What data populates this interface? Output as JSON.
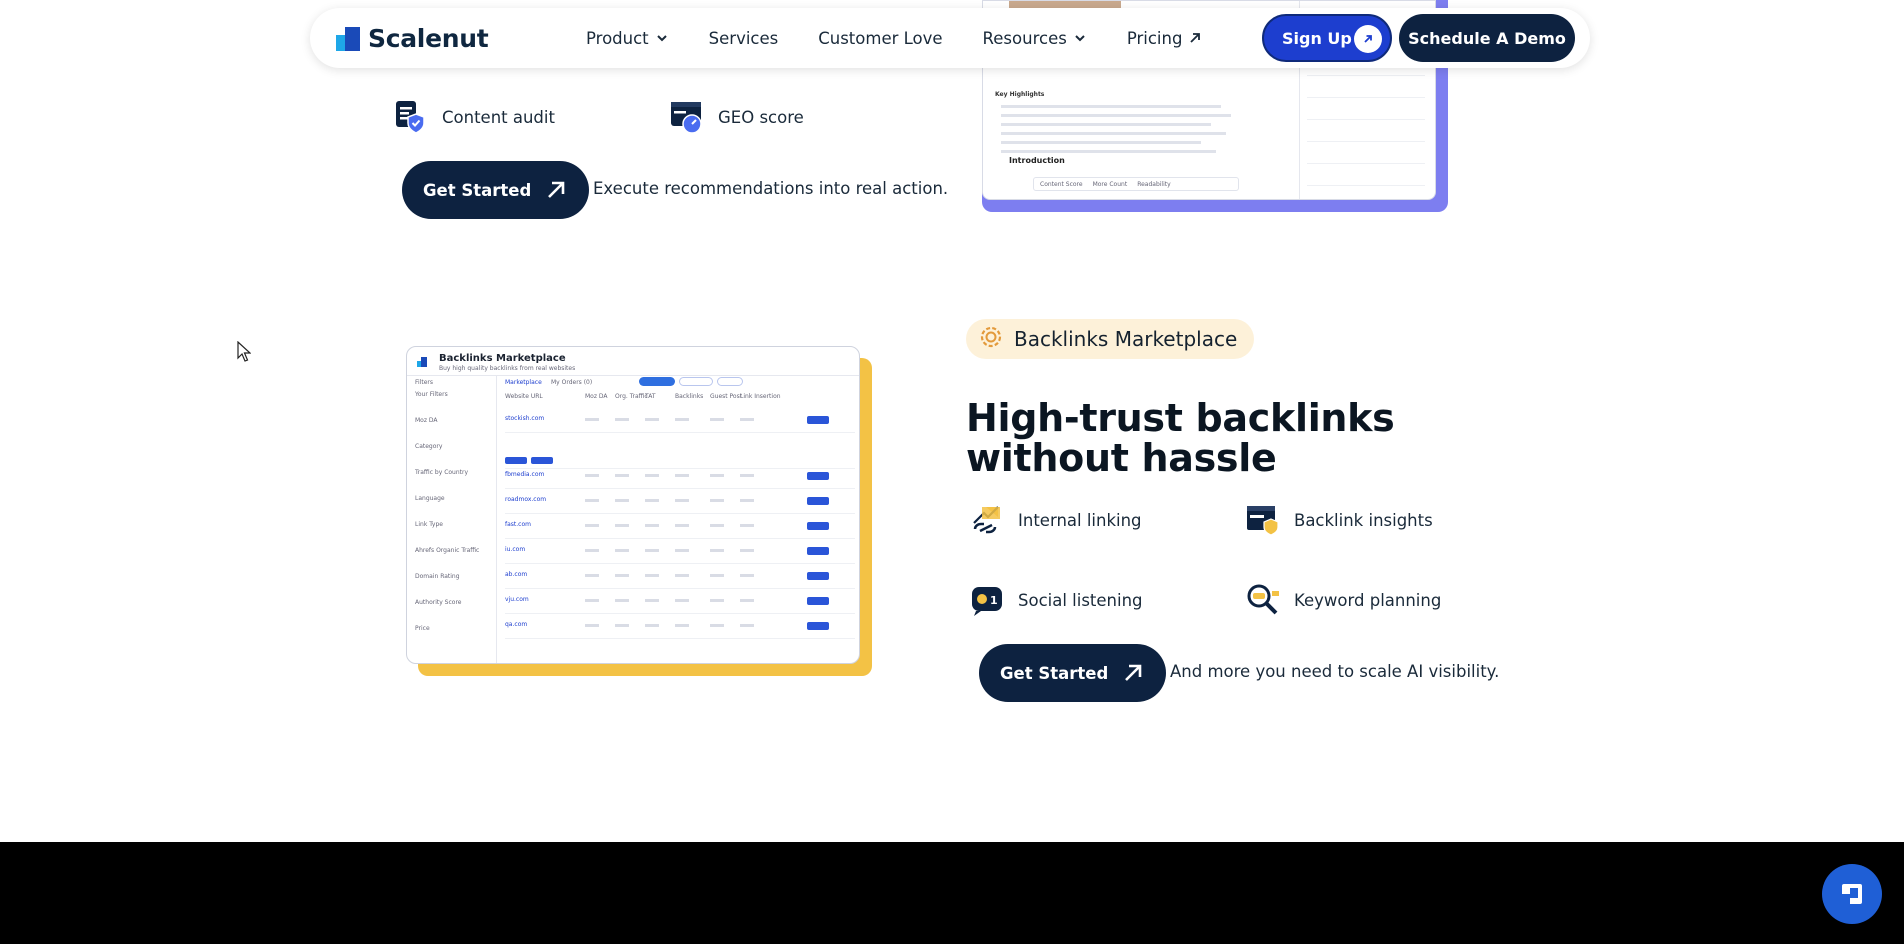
{
  "nav": {
    "brand": "Scalenut",
    "links": [
      {
        "label": "Product",
        "dropdown": true
      },
      {
        "label": "Services",
        "dropdown": false
      },
      {
        "label": "Customer Love",
        "dropdown": false
      },
      {
        "label": "Resources",
        "dropdown": true
      },
      {
        "label": "Pricing",
        "external": true
      }
    ],
    "signup_label": "Sign Up",
    "demo_label": "Schedule A Demo"
  },
  "top_section": {
    "features": [
      {
        "label": "Content audit",
        "icon": "content-audit-icon"
      },
      {
        "label": "GEO score",
        "icon": "geo-score-icon"
      }
    ],
    "cta_label": "Get Started",
    "caption": "Execute recommendations into real action.",
    "preview": {
      "key_highlights": "Key Highlights",
      "introduction": "Introduction",
      "content_score": "Content Score",
      "more_count": "More Count",
      "readability": "Readability"
    }
  },
  "backlinks_section": {
    "badge": "Backlinks Marketplace",
    "heading": "High-trust backlinks without hassle",
    "features": [
      {
        "label": "Internal linking",
        "icon": "internal-linking-icon"
      },
      {
        "label": "Backlink insights",
        "icon": "backlink-insights-icon"
      },
      {
        "label": "Social listening",
        "icon": "social-listening-icon"
      },
      {
        "label": "Keyword planning",
        "icon": "keyword-planning-icon"
      }
    ],
    "cta_label": "Get Started",
    "caption": "And more you need to scale AI visibility.",
    "preview": {
      "title": "Backlinks Marketplace",
      "subtitle": "Buy high quality backlinks from real websites",
      "tabs": [
        "Marketplace",
        "My Orders (0)"
      ],
      "filters_label": "Filters",
      "sidebar_groups": [
        "Your Filters",
        "Moz DA",
        "Category",
        "Traffic by Country",
        "Language",
        "Link Type",
        "Ahrefs Organic Traffic",
        "Domain Rating",
        "Authority Score",
        "Price"
      ],
      "column_headers": [
        "Website URL",
        "Moz DA",
        "Org. Traffic",
        "TAT",
        "Backlinks",
        "Guest Post",
        "Link Insertion"
      ],
      "rows": [
        "stockish.com",
        "fbmedia.com",
        "roadmox.com",
        "fast.com",
        "iu.com",
        "ab.com",
        "vju.com",
        "qa.com"
      ]
    }
  },
  "colors": {
    "navy": "#0d2240",
    "blue": "#1d3ecf",
    "footer": "#000000",
    "badge_bg": "#fdf1d9",
    "yellow": "#f3c245",
    "violet": "#7d7ef0"
  }
}
